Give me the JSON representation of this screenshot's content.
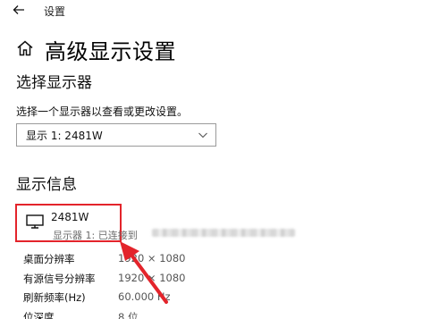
{
  "window": {
    "title": "设置"
  },
  "header": {
    "back_icon": "back-arrow-icon",
    "home_icon": "home-icon",
    "title": "高级显示设置"
  },
  "select_display": {
    "heading": "选择显示器",
    "description": "选择一个显示器以查看或更改设置。",
    "selected_option": "显示 1: 2481W"
  },
  "display_info": {
    "heading": "显示信息",
    "monitor_icon": "monitor-icon",
    "name": "2481W",
    "status": "显示器 1: 已连接到",
    "highlight_color": "#e3242b",
    "rows": [
      {
        "label": "桌面分辨率",
        "value": "1920 × 1080"
      },
      {
        "label": "有源信号分辨率",
        "value": "1920 × 1080"
      },
      {
        "label": "刷新频率(Hz)",
        "value": "60.000 Hz"
      },
      {
        "label": "位深度",
        "value": "8 位"
      }
    ]
  },
  "colors": {
    "annotation_red": "#e3242b",
    "secondary_text": "#6b6b6b"
  }
}
